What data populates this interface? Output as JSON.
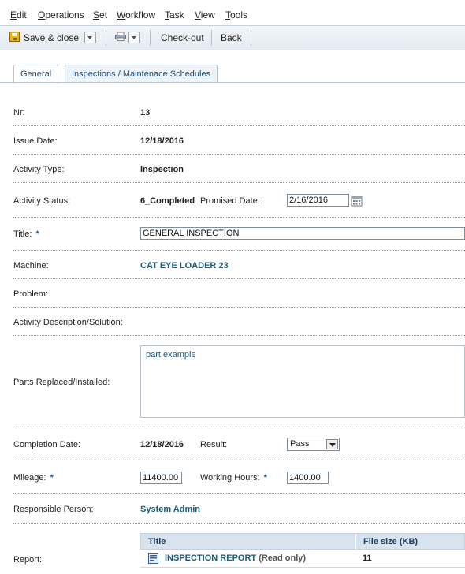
{
  "menu": {
    "edit": {
      "hot": "E",
      "rest": "dit"
    },
    "operations": {
      "hot": "O",
      "rest": "perations"
    },
    "set": {
      "hot": "S",
      "rest": "et"
    },
    "workflow": {
      "hot": "W",
      "rest": "orkflow"
    },
    "task": {
      "hot": "T",
      "rest": "ask"
    },
    "view": {
      "hot": "V",
      "rest": "iew"
    },
    "tools": {
      "hot": "T",
      "rest": "ools"
    }
  },
  "toolbar": {
    "save_close": "Save & close",
    "checkout": "Check-out",
    "back": "Back"
  },
  "tabs": {
    "general": "General",
    "inspections": "Inspections / Maintenace Schedules"
  },
  "form": {
    "nr": {
      "label": "Nr:",
      "value": "13"
    },
    "issue_date": {
      "label": "Issue Date:",
      "value": "12/18/2016"
    },
    "activity_type": {
      "label": "Activity Type:",
      "value": "Inspection"
    },
    "activity_status": {
      "label": "Activity Status:",
      "value": "6_Completed"
    },
    "promised_date": {
      "label": "Promised Date:",
      "value": "2/16/2016"
    },
    "title": {
      "label": "Title:",
      "required_mark": "*",
      "value": "GENERAL INSPECTION"
    },
    "machine": {
      "label": "Machine:",
      "value": "CAT EYE LOADER 23"
    },
    "problem": {
      "label": "Problem:"
    },
    "activity_description": {
      "label": "Activity Description/Solution:"
    },
    "parts": {
      "label": "Parts Replaced/Installed:",
      "value": "part example"
    },
    "completion_date": {
      "label": "Completion Date:",
      "value": "12/18/2016"
    },
    "result": {
      "label": "Result:",
      "value": "Pass"
    },
    "mileage": {
      "label": "Mileage:",
      "required_mark": "*",
      "value": "11400.00"
    },
    "working_hours": {
      "label": "Working Hours:",
      "required_mark": "*",
      "value": "1400.00"
    },
    "responsible": {
      "label": "Responsible Person:",
      "value": "System Admin"
    },
    "report": {
      "label": "Report:",
      "columns": [
        "Title",
        "File size (KB)"
      ],
      "rows": [
        {
          "title": "INSPECTION REPORT",
          "note": "(Read only)",
          "size": "11"
        }
      ]
    }
  }
}
